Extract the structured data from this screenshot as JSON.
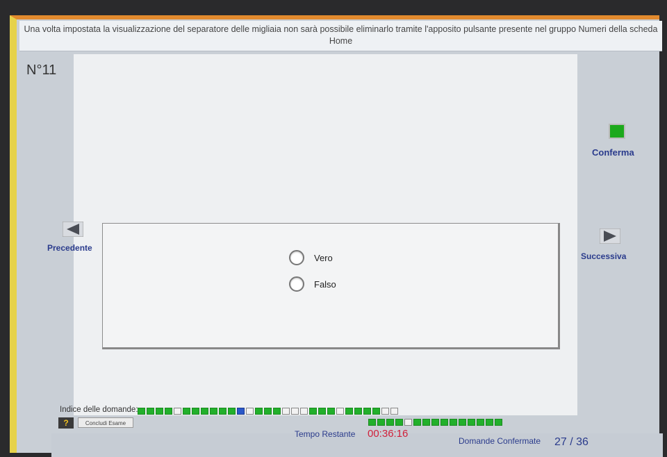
{
  "question": {
    "text": "Una volta impostata la visualizzazione del separatore delle migliaia non sarà possibile eliminarlo tramite l'apposito pulsante presente nel gruppo Numeri della scheda Home",
    "number": "N°11"
  },
  "answers": [
    {
      "label": "Vero"
    },
    {
      "label": "Falso"
    }
  ],
  "nav": {
    "confirm": "Conferma",
    "previous": "Precedente",
    "next": "Successiva"
  },
  "index": {
    "label": "Indice delle domande:",
    "row1": [
      "g",
      "g",
      "g",
      "g",
      "w",
      "g",
      "g",
      "g",
      "g",
      "g",
      "g",
      "b",
      "w",
      "g",
      "g",
      "g",
      "w",
      "w",
      "w",
      "g",
      "g",
      "g",
      "w",
      "g",
      "g",
      "g",
      "g",
      "w",
      "w"
    ],
    "row2": [
      "g",
      "g",
      "g",
      "g",
      "w",
      "g",
      "g",
      "g",
      "g",
      "g",
      "g",
      "g",
      "g",
      "g",
      "g"
    ]
  },
  "footer": {
    "help": "?",
    "end_exam": "Concludi Esame",
    "time_label": "Tempo Restante",
    "time_value": "00:36:16",
    "confirmed_label": "Domande Confermate",
    "confirmed_value": "27 / 36"
  },
  "colors": {
    "accent_blue": "#2a3b8c",
    "timer_red": "#d0203a",
    "answered_green": "#22b02b",
    "current_blue": "#2a58c8"
  }
}
